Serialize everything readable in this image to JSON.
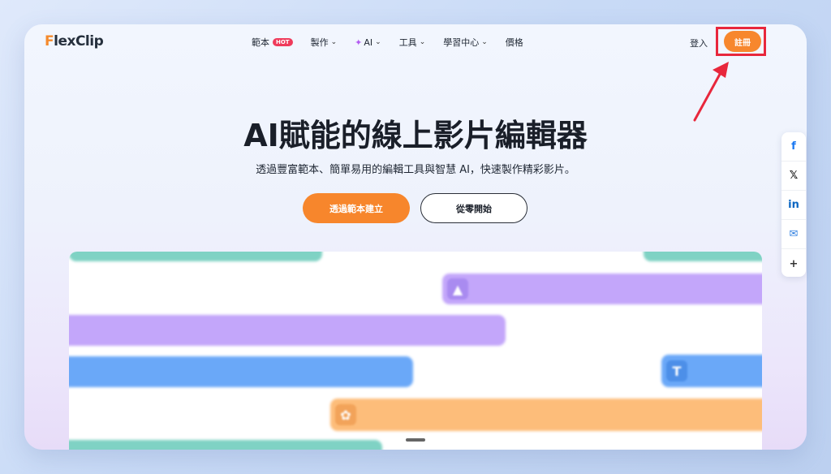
{
  "brand": {
    "logo_first": "F",
    "logo_rest": "lexClip"
  },
  "nav": {
    "items": [
      {
        "label": "範本",
        "badge": "HOT",
        "dropdown": false
      },
      {
        "label": "製作",
        "dropdown": true
      },
      {
        "label": "AI",
        "dropdown": true,
        "icon": "sparkle-icon"
      },
      {
        "label": "工具",
        "dropdown": true
      },
      {
        "label": "學習中心",
        "dropdown": true
      },
      {
        "label": "價格",
        "dropdown": false
      }
    ],
    "login": "登入",
    "signup": "註冊"
  },
  "hero": {
    "title": "AI賦能的線上影片編輯器",
    "subtitle": "透過豐富範本、簡單易用的編輯工具與智慧 AI，快速製作精彩影片。",
    "primary_button": "透過範本建立",
    "secondary_button": "從零開始"
  },
  "timeline": {
    "chip_text_symbol": "T",
    "track_colors": {
      "teal": "#7fd2c4",
      "purple": "#c3a6fa",
      "blue": "#6aa8f8",
      "orange": "#fdbd7a"
    }
  },
  "share": {
    "items": [
      {
        "name": "facebook",
        "glyph": "f",
        "color": "#1877f2"
      },
      {
        "name": "x",
        "glyph": "𝕏",
        "color": "#111111"
      },
      {
        "name": "linkedin",
        "glyph": "in",
        "color": "#0a66c2"
      },
      {
        "name": "email",
        "glyph": "✉",
        "color": "#2f7fe0"
      },
      {
        "name": "more",
        "glyph": "+",
        "color": "#333333"
      }
    ]
  },
  "colors": {
    "accent": "#f7872d",
    "highlight_box": "#e8273c",
    "hot_badge": "#ef3b5b"
  }
}
